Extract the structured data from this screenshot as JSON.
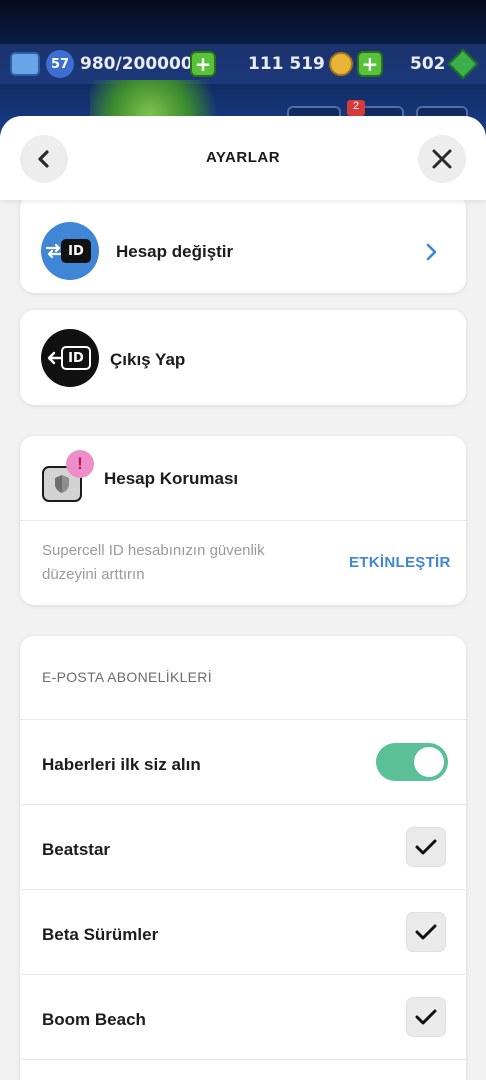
{
  "hud": {
    "level": "57",
    "xp": "980/200000",
    "coins": "111 519",
    "gems": "502",
    "notification_count": "2"
  },
  "header": {
    "title": "AYARLAR"
  },
  "account": {
    "switch_label": "Hesap değiştir",
    "logout_label": "Çıkış Yap",
    "id_badge": "ID"
  },
  "protection": {
    "title": "Hesap Koruması",
    "warning_mark": "!",
    "description": "Supercell ID hesabınızın güvenlik düzeyini arttırın",
    "action": "ETKİNLEŞTİR"
  },
  "subscriptions": {
    "section_title": "E-POSTA ABONELİKLERİ",
    "items": [
      {
        "label": "Haberleri ilk siz alın",
        "control": "toggle",
        "checked": true
      },
      {
        "label": "Beatstar",
        "control": "checkbox",
        "checked": true
      },
      {
        "label": "Beta Sürümler",
        "control": "checkbox",
        "checked": true
      },
      {
        "label": "Boom Beach",
        "control": "checkbox",
        "checked": true
      }
    ]
  },
  "colors": {
    "accent": "#3f86d6",
    "toggle_on": "#5bbf97",
    "warning": "#ee8ec8",
    "switch_icon_bg": "#3f86d6"
  }
}
